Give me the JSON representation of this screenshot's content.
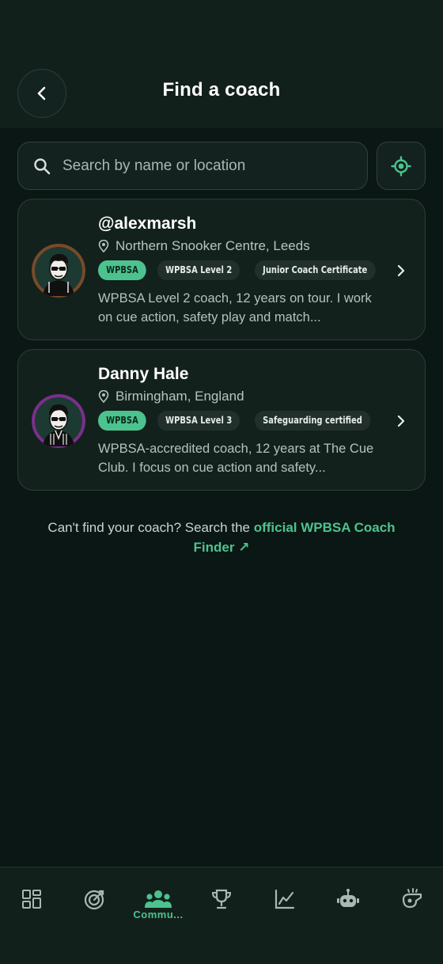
{
  "header": {
    "title": "Find a coach"
  },
  "search": {
    "placeholder": "Search by name or location"
  },
  "coaches": [
    {
      "name": "@alexmarsh",
      "location": "Northern Snooker Centre, Leeds",
      "tags": [
        "WPBSA",
        "WPBSA Level 2",
        "Junior Coach Certificate"
      ],
      "bio": "WPBSA Level 2 coach, 12 years on tour. I work on cue action, safety play and match...",
      "ring_color": "#7a4a2a"
    },
    {
      "name": "Danny Hale",
      "location": "Birmingham, England",
      "tags": [
        "WPBSA",
        "WPBSA Level 3",
        "Safeguarding certified"
      ],
      "bio": "WPBSA-accredited coach, 12 years at The Cue Club. I focus on cue action and safety...",
      "ring_color": "#7b2f8c"
    }
  ],
  "footer": {
    "prefix": "Can't find your coach? Search the ",
    "link": "official WPBSA Coach Finder ↗"
  },
  "tabbar": {
    "items": [
      "dashboard-icon",
      "target-icon",
      "community-icon",
      "trophy-icon",
      "stats-chart-icon",
      "robot-icon",
      "whistle-icon"
    ],
    "active_label": "Commu..."
  },
  "colors": {
    "accent": "#4cc38f",
    "background": "#0b1714"
  }
}
